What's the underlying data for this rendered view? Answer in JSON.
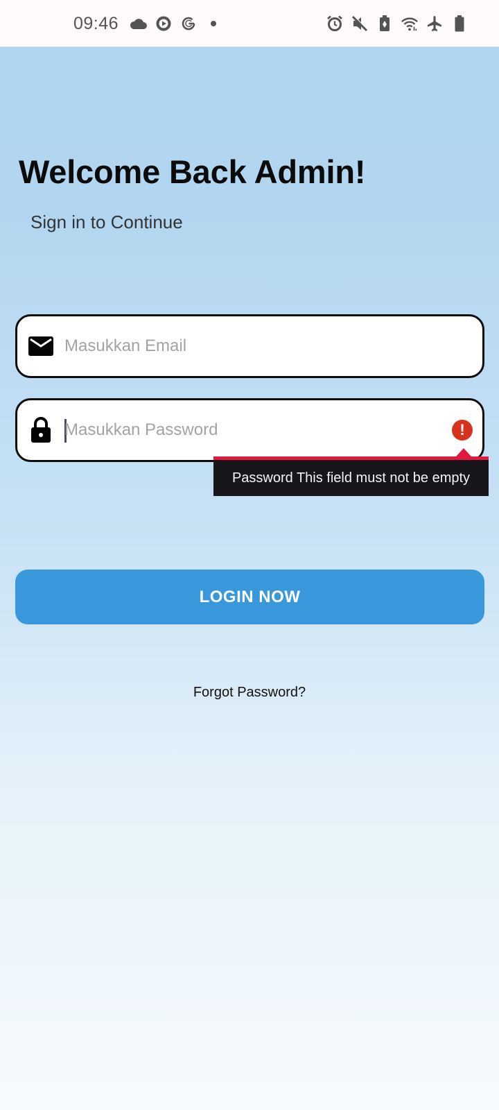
{
  "status_bar": {
    "time": "09:46",
    "left_icons": [
      "cloud-icon",
      "play-circle-icon",
      "google-icon",
      "dot-icon"
    ],
    "right_icons": [
      "alarm-icon",
      "mute-icon",
      "battery-saver-icon",
      "wifi-icon",
      "airplane-icon",
      "battery-icon"
    ]
  },
  "header": {
    "title": "Welcome Back Admin!",
    "subtitle": "Sign in to Continue"
  },
  "form": {
    "email": {
      "placeholder": "Masukkan Email",
      "value": ""
    },
    "password": {
      "placeholder": "Masukkan Password",
      "value": ""
    },
    "error_message": "Password This field must not be empty",
    "login_label": "LOGIN NOW",
    "forgot_label": "Forgot Password?"
  },
  "colors": {
    "button": "#3997dc",
    "error": "#d7321c",
    "tooltip_bg": "#17171b",
    "tooltip_accent": "#e1193c"
  }
}
